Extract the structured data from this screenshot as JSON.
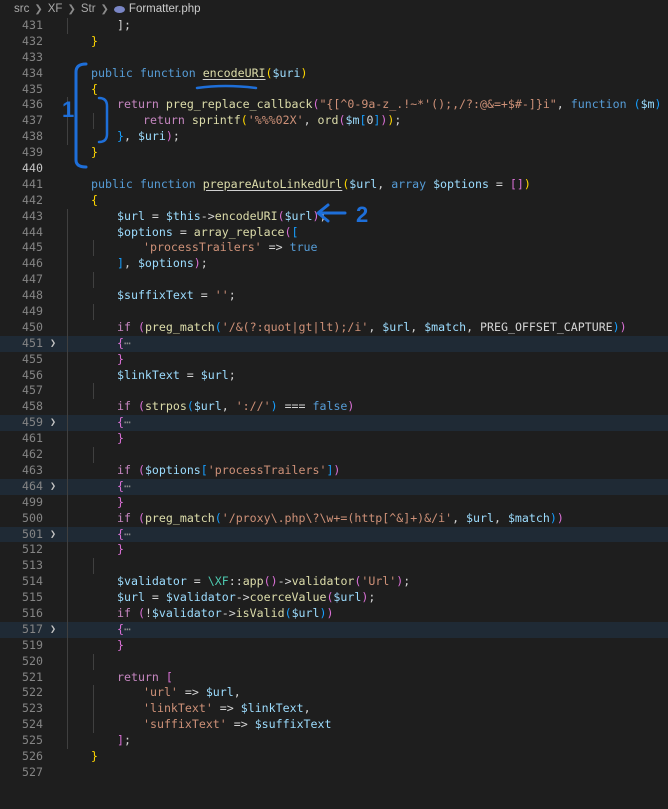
{
  "breadcrumb": {
    "parts": [
      "src",
      "XF",
      "Str"
    ],
    "file": "Formatter.php"
  },
  "annotations": {
    "label_1": "1",
    "label_2": "2",
    "color": "#1e6fd9"
  },
  "code_lines": [
    {
      "n": "431",
      "indent": 2,
      "t": [
        [
          "pun",
          "];"
        ]
      ]
    },
    {
      "n": "432",
      "indent": 1,
      "t": [
        [
          "brk1",
          "}"
        ]
      ]
    },
    {
      "n": "433",
      "indent": 0,
      "t": []
    },
    {
      "n": "434",
      "indent": 1,
      "t": [
        [
          "kw",
          "public "
        ],
        [
          "kw",
          "function "
        ],
        [
          "fn ul",
          "encodeURI"
        ],
        [
          "brk1",
          "("
        ],
        [
          "var",
          "$uri"
        ],
        [
          "brk1",
          ")"
        ]
      ]
    },
    {
      "n": "435",
      "indent": 1,
      "t": [
        [
          "brk1",
          "{"
        ]
      ]
    },
    {
      "n": "436",
      "indent": 2,
      "t": [
        [
          "kwc",
          "return "
        ],
        [
          "fn",
          "preg_replace_callback"
        ],
        [
          "brk2",
          "("
        ],
        [
          "str",
          "\"{[^0-9a-z_.!~*'();,/?:@&=+$#-]}i\""
        ],
        [
          "pun",
          ", "
        ],
        [
          "kw",
          "function "
        ],
        [
          "brk3",
          "("
        ],
        [
          "var",
          "$m"
        ],
        [
          "brk3",
          ")"
        ],
        [
          "pun",
          " "
        ],
        [
          "brk3",
          "{"
        ]
      ]
    },
    {
      "n": "437",
      "indent": 3,
      "t": [
        [
          "kwc",
          "return "
        ],
        [
          "fn",
          "sprintf"
        ],
        [
          "brk1",
          "("
        ],
        [
          "str",
          "'%%%02X'"
        ],
        [
          "pun",
          ", "
        ],
        [
          "fn",
          "ord"
        ],
        [
          "brk2",
          "("
        ],
        [
          "var",
          "$m"
        ],
        [
          "brk3",
          "["
        ],
        [
          "pun",
          "0"
        ],
        [
          "brk3",
          "]"
        ],
        [
          "brk2",
          ")"
        ],
        [
          "brk1",
          ")"
        ],
        [
          "pun",
          ";"
        ]
      ]
    },
    {
      "n": "438",
      "indent": 2,
      "t": [
        [
          "brk3",
          "}"
        ],
        [
          "pun",
          ", "
        ],
        [
          "var",
          "$uri"
        ],
        [
          "brk2",
          ")"
        ],
        [
          "pun",
          ";"
        ]
      ]
    },
    {
      "n": "439",
      "indent": 1,
      "t": [
        [
          "brk1",
          "}"
        ]
      ]
    },
    {
      "n": "440",
      "indent": 0,
      "cur": true,
      "t": []
    },
    {
      "n": "441",
      "indent": 1,
      "t": [
        [
          "kw",
          "public "
        ],
        [
          "kw",
          "function "
        ],
        [
          "fn ul",
          "prepareAutoLinkedUrl"
        ],
        [
          "brk1",
          "("
        ],
        [
          "var",
          "$url"
        ],
        [
          "pun",
          ", "
        ],
        [
          "kw",
          "array "
        ],
        [
          "var",
          "$options"
        ],
        [
          "pun",
          " = "
        ],
        [
          "brk2",
          "[]"
        ],
        [
          "brk1",
          ")"
        ]
      ]
    },
    {
      "n": "442",
      "indent": 1,
      "t": [
        [
          "brk1",
          "{"
        ]
      ]
    },
    {
      "n": "443",
      "indent": 2,
      "t": [
        [
          "var",
          "$url"
        ],
        [
          "pun",
          " = "
        ],
        [
          "var",
          "$this"
        ],
        [
          "pun",
          "->"
        ],
        [
          "fn",
          "encodeURI"
        ],
        [
          "brk2",
          "("
        ],
        [
          "var",
          "$url"
        ],
        [
          "brk2",
          ")"
        ],
        [
          "pun",
          ";"
        ]
      ]
    },
    {
      "n": "444",
      "indent": 2,
      "t": [
        [
          "var",
          "$options"
        ],
        [
          "pun",
          " = "
        ],
        [
          "fn",
          "array_replace"
        ],
        [
          "brk2",
          "("
        ],
        [
          "brk3",
          "["
        ]
      ]
    },
    {
      "n": "445",
      "indent": 3,
      "t": [
        [
          "str",
          "'processTrailers'"
        ],
        [
          "pun",
          " => "
        ],
        [
          "kw",
          "true"
        ]
      ]
    },
    {
      "n": "446",
      "indent": 2,
      "t": [
        [
          "brk3",
          "]"
        ],
        [
          "pun",
          ", "
        ],
        [
          "var",
          "$options"
        ],
        [
          "brk2",
          ")"
        ],
        [
          "pun",
          ";"
        ]
      ]
    },
    {
      "n": "447",
      "indent": 2,
      "t": []
    },
    {
      "n": "448",
      "indent": 2,
      "t": [
        [
          "var",
          "$suffixText"
        ],
        [
          "pun",
          " = "
        ],
        [
          "str",
          "''"
        ],
        [
          "pun",
          ";"
        ]
      ]
    },
    {
      "n": "449",
      "indent": 2,
      "t": []
    },
    {
      "n": "450",
      "indent": 2,
      "t": [
        [
          "kwc",
          "if "
        ],
        [
          "brk2",
          "("
        ],
        [
          "fn",
          "preg_match"
        ],
        [
          "brk3",
          "("
        ],
        [
          "str",
          "'/&(?:quot|gt|lt);/i'"
        ],
        [
          "pun",
          ", "
        ],
        [
          "var",
          "$url"
        ],
        [
          "pun",
          ", "
        ],
        [
          "var",
          "$match"
        ],
        [
          "pun",
          ", "
        ],
        [
          "pun",
          "PREG_OFFSET_CAPTURE"
        ],
        [
          "brk3",
          ")"
        ],
        [
          "brk2",
          ")"
        ]
      ]
    },
    {
      "n": "451",
      "indent": 2,
      "fold": true,
      "t": [
        [
          "brk2",
          "{"
        ],
        [
          "fold-dots",
          "⋯"
        ]
      ]
    },
    {
      "n": "455",
      "indent": 2,
      "t": [
        [
          "brk2",
          "}"
        ]
      ]
    },
    {
      "n": "456",
      "indent": 2,
      "t": [
        [
          "var",
          "$linkText"
        ],
        [
          "pun",
          " = "
        ],
        [
          "var",
          "$url"
        ],
        [
          "pun",
          ";"
        ]
      ]
    },
    {
      "n": "457",
      "indent": 2,
      "t": []
    },
    {
      "n": "458",
      "indent": 2,
      "t": [
        [
          "kwc",
          "if "
        ],
        [
          "brk2",
          "("
        ],
        [
          "fn",
          "strpos"
        ],
        [
          "brk3",
          "("
        ],
        [
          "var",
          "$url"
        ],
        [
          "pun",
          ", "
        ],
        [
          "str",
          "'://'"
        ],
        [
          "brk3",
          ")"
        ],
        [
          "pun",
          " === "
        ],
        [
          "kw",
          "false"
        ],
        [
          "brk2",
          ")"
        ]
      ]
    },
    {
      "n": "459",
      "indent": 2,
      "fold": true,
      "t": [
        [
          "brk2",
          "{"
        ],
        [
          "fold-dots",
          "⋯"
        ]
      ]
    },
    {
      "n": "461",
      "indent": 2,
      "t": [
        [
          "brk2",
          "}"
        ]
      ]
    },
    {
      "n": "462",
      "indent": 2,
      "t": []
    },
    {
      "n": "463",
      "indent": 2,
      "t": [
        [
          "kwc",
          "if "
        ],
        [
          "brk2",
          "("
        ],
        [
          "var",
          "$options"
        ],
        [
          "brk3",
          "["
        ],
        [
          "str",
          "'processTrailers'"
        ],
        [
          "brk3",
          "]"
        ],
        [
          "brk2",
          ")"
        ]
      ]
    },
    {
      "n": "464",
      "indent": 2,
      "fold": true,
      "t": [
        [
          "brk2",
          "{"
        ],
        [
          "fold-dots",
          "⋯"
        ]
      ]
    },
    {
      "n": "499",
      "indent": 2,
      "t": [
        [
          "brk2",
          "}"
        ]
      ]
    },
    {
      "n": "500",
      "indent": 2,
      "t": [
        [
          "kwc",
          "if "
        ],
        [
          "brk2",
          "("
        ],
        [
          "fn",
          "preg_match"
        ],
        [
          "brk3",
          "("
        ],
        [
          "str",
          "'/proxy\\.php\\?\\w+=(http[^&]+)&/i'"
        ],
        [
          "pun",
          ", "
        ],
        [
          "var",
          "$url"
        ],
        [
          "pun",
          ", "
        ],
        [
          "var",
          "$match"
        ],
        [
          "brk3",
          ")"
        ],
        [
          "brk2",
          ")"
        ]
      ]
    },
    {
      "n": "501",
      "indent": 2,
      "fold": true,
      "t": [
        [
          "brk2",
          "{"
        ],
        [
          "fold-dots",
          "⋯"
        ]
      ]
    },
    {
      "n": "512",
      "indent": 2,
      "t": [
        [
          "brk2",
          "}"
        ]
      ]
    },
    {
      "n": "513",
      "indent": 2,
      "t": []
    },
    {
      "n": "514",
      "indent": 2,
      "t": [
        [
          "var",
          "$validator"
        ],
        [
          "pun",
          " = "
        ],
        [
          "cls",
          "\\XF"
        ],
        [
          "pun",
          "::"
        ],
        [
          "fn",
          "app"
        ],
        [
          "brk2",
          "()"
        ],
        [
          "pun",
          "->"
        ],
        [
          "fn",
          "validator"
        ],
        [
          "brk2",
          "("
        ],
        [
          "str",
          "'Url'"
        ],
        [
          "brk2",
          ")"
        ],
        [
          "pun",
          ";"
        ]
      ]
    },
    {
      "n": "515",
      "indent": 2,
      "t": [
        [
          "var",
          "$url"
        ],
        [
          "pun",
          " = "
        ],
        [
          "var",
          "$validator"
        ],
        [
          "pun",
          "->"
        ],
        [
          "fn",
          "coerceValue"
        ],
        [
          "brk2",
          "("
        ],
        [
          "var",
          "$url"
        ],
        [
          "brk2",
          ")"
        ],
        [
          "pun",
          ";"
        ]
      ]
    },
    {
      "n": "516",
      "indent": 2,
      "t": [
        [
          "kwc",
          "if "
        ],
        [
          "brk2",
          "("
        ],
        [
          "pun",
          "!"
        ],
        [
          "var",
          "$validator"
        ],
        [
          "pun",
          "->"
        ],
        [
          "fn",
          "isValid"
        ],
        [
          "brk3",
          "("
        ],
        [
          "var",
          "$url"
        ],
        [
          "brk3",
          ")"
        ],
        [
          "brk2",
          ")"
        ]
      ]
    },
    {
      "n": "517",
      "indent": 2,
      "fold": true,
      "t": [
        [
          "brk2",
          "{"
        ],
        [
          "fold-dots",
          "⋯"
        ]
      ]
    },
    {
      "n": "519",
      "indent": 2,
      "t": [
        [
          "brk2",
          "}"
        ]
      ]
    },
    {
      "n": "520",
      "indent": 2,
      "t": []
    },
    {
      "n": "521",
      "indent": 2,
      "t": [
        [
          "kwc",
          "return "
        ],
        [
          "brk2",
          "["
        ]
      ]
    },
    {
      "n": "522",
      "indent": 3,
      "t": [
        [
          "str",
          "'url'"
        ],
        [
          "pun",
          " => "
        ],
        [
          "var",
          "$url"
        ],
        [
          "pun",
          ","
        ]
      ]
    },
    {
      "n": "523",
      "indent": 3,
      "t": [
        [
          "str",
          "'linkText'"
        ],
        [
          "pun",
          " => "
        ],
        [
          "var",
          "$linkText"
        ],
        [
          "pun",
          ","
        ]
      ]
    },
    {
      "n": "524",
      "indent": 3,
      "t": [
        [
          "str",
          "'suffixText'"
        ],
        [
          "pun",
          " => "
        ],
        [
          "var",
          "$suffixText"
        ]
      ]
    },
    {
      "n": "525",
      "indent": 2,
      "t": [
        [
          "brk2",
          "]"
        ],
        [
          "pun",
          ";"
        ]
      ]
    },
    {
      "n": "526",
      "indent": 1,
      "t": [
        [
          "brk1",
          "}"
        ]
      ]
    },
    {
      "n": "527",
      "indent": 0,
      "t": []
    }
  ]
}
